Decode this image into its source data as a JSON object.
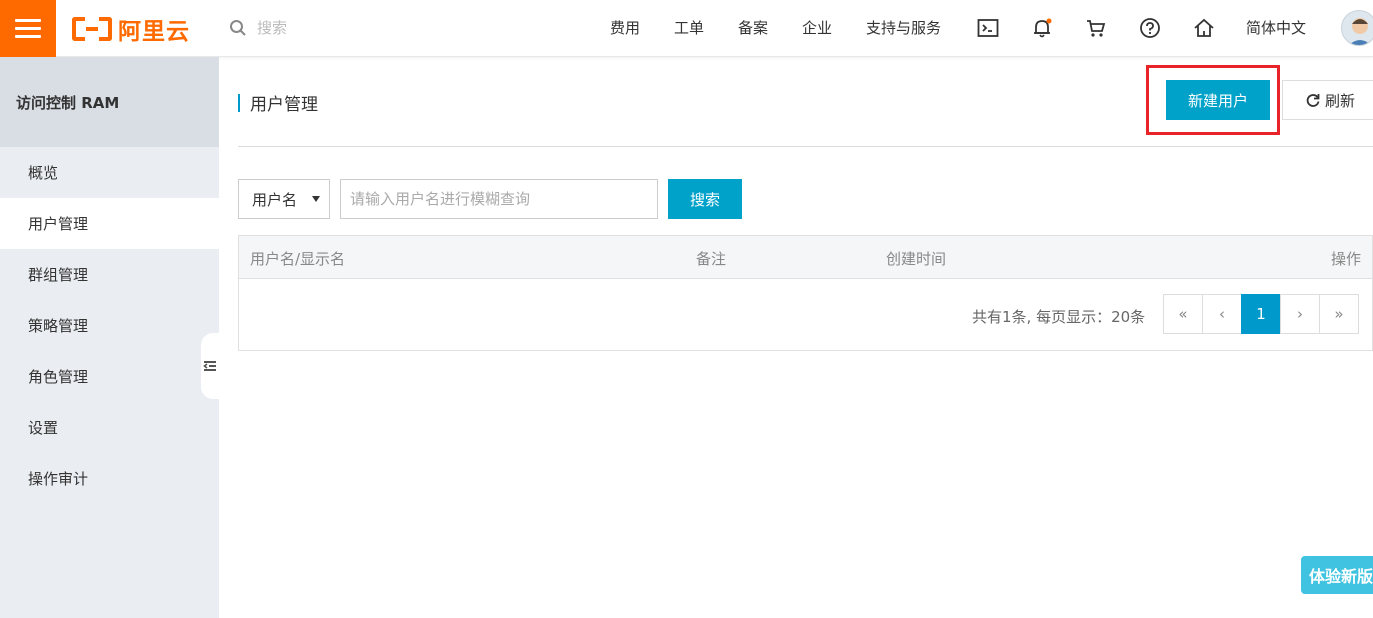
{
  "topbar": {
    "logo_text": "阿里云",
    "search_placeholder": "搜索",
    "nav": [
      "费用",
      "工单",
      "备案",
      "企业",
      "支持与服务"
    ],
    "language": "简体中文",
    "icons": [
      "terminal-icon",
      "bell-icon",
      "cart-icon",
      "help-icon",
      "home-icon"
    ],
    "accent_color": "#ff6a00"
  },
  "sidebar": {
    "title": "访问控制 RAM",
    "items": [
      {
        "label": "概览"
      },
      {
        "label": "用户管理",
        "active": true
      },
      {
        "label": "群组管理"
      },
      {
        "label": "策略管理"
      },
      {
        "label": "角色管理"
      },
      {
        "label": "设置"
      },
      {
        "label": "操作审计"
      }
    ]
  },
  "main": {
    "title": "用户管理",
    "new_user_label": "新建用户",
    "refresh_label": "刷新",
    "filter": {
      "select_value": "用户名",
      "placeholder": "请输入用户名进行模糊查询",
      "search_label": "搜索"
    },
    "table": {
      "columns": [
        "用户名/显示名",
        "备注",
        "创建时间",
        "操作"
      ],
      "rows": []
    },
    "pager": {
      "info": "共有1条, 每页显示：20条",
      "buttons": [
        "«",
        "‹",
        "1",
        "›",
        "»"
      ],
      "current": "1"
    },
    "primary_color": "#00a2ca"
  },
  "try_new_label": "体验新版"
}
